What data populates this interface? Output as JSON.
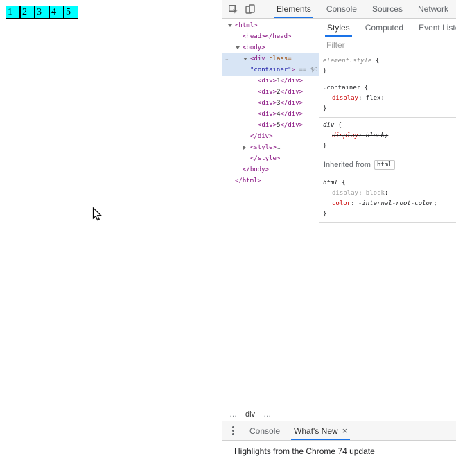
{
  "page": {
    "flex_items": [
      "1",
      "2",
      "3",
      "4",
      "5"
    ],
    "box_color": "#00ffff"
  },
  "devtools": {
    "colors": {
      "accent_blue": "#1a73e8",
      "selection": "#d8e5f5",
      "tag": "#881280",
      "attr_name": "#994500",
      "attr_value": "#1a1aa6",
      "prop_name": "#c80000"
    },
    "main_tabs": [
      {
        "label": "Elements",
        "selected": true
      },
      {
        "label": "Console",
        "selected": false
      },
      {
        "label": "Sources",
        "selected": false
      },
      {
        "label": "Network",
        "selected": false
      }
    ],
    "elements_tree": {
      "lines": [
        {
          "indent": 0,
          "arrow": "down",
          "tokens": [
            {
              "c": "tag",
              "t": "<html>"
            }
          ]
        },
        {
          "indent": 1,
          "tokens": [
            {
              "c": "tag",
              "t": "<head></head>"
            }
          ]
        },
        {
          "indent": 1,
          "arrow": "down",
          "tokens": [
            {
              "c": "tag",
              "t": "<body>"
            }
          ]
        },
        {
          "indent": 2,
          "arrow": "down",
          "selected": true,
          "gutter": "…",
          "tokens": [
            {
              "c": "tag",
              "t": "<div"
            },
            {
              "c": "attr",
              "t": " class="
            }
          ]
        },
        {
          "indent": 2,
          "selected": true,
          "tokens": [
            {
              "c": "val",
              "t": "\"container\""
            },
            {
              "c": "tag",
              "t": ">"
            },
            {
              "c": "anno",
              "t": " == $0"
            }
          ]
        },
        {
          "indent": 3,
          "tokens": [
            {
              "c": "tag",
              "t": "<div>"
            },
            {
              "c": "txt",
              "t": "1"
            },
            {
              "c": "tag",
              "t": "</div>"
            }
          ]
        },
        {
          "indent": 3,
          "tokens": [
            {
              "c": "tag",
              "t": "<div>"
            },
            {
              "c": "txt",
              "t": "2"
            },
            {
              "c": "tag",
              "t": "</div>"
            }
          ]
        },
        {
          "indent": 3,
          "tokens": [
            {
              "c": "tag",
              "t": "<div>"
            },
            {
              "c": "txt",
              "t": "3"
            },
            {
              "c": "tag",
              "t": "</div>"
            }
          ]
        },
        {
          "indent": 3,
          "tokens": [
            {
              "c": "tag",
              "t": "<div>"
            },
            {
              "c": "txt",
              "t": "4"
            },
            {
              "c": "tag",
              "t": "</div>"
            }
          ]
        },
        {
          "indent": 3,
          "tokens": [
            {
              "c": "tag",
              "t": "<div>"
            },
            {
              "c": "txt",
              "t": "5"
            },
            {
              "c": "tag",
              "t": "</div>"
            }
          ]
        },
        {
          "indent": 2,
          "tokens": [
            {
              "c": "tag",
              "t": "</div>"
            }
          ]
        },
        {
          "indent": 2,
          "arrow": "right",
          "tokens": [
            {
              "c": "tag",
              "t": "<style>"
            },
            {
              "c": "anno",
              "t": "…"
            }
          ]
        },
        {
          "indent": 2,
          "tokens": [
            {
              "c": "tag",
              "t": "</style>"
            }
          ]
        },
        {
          "indent": 1,
          "tokens": [
            {
              "c": "tag",
              "t": "</body>"
            }
          ]
        },
        {
          "indent": 0,
          "tokens": [
            {
              "c": "tag",
              "t": "</html>"
            }
          ]
        }
      ]
    },
    "breadcrumb": [
      {
        "t": "…",
        "current": false
      },
      {
        "t": "div",
        "current": true
      },
      {
        "t": "…",
        "current": false
      }
    ],
    "styles_pane": {
      "tabs": [
        {
          "label": "Styles",
          "selected": true
        },
        {
          "label": "Computed",
          "selected": false
        },
        {
          "label": "Event Listeners",
          "selected": false
        }
      ],
      "filter_placeholder": "Filter",
      "sections": [
        {
          "kind": "rule",
          "selector": [
            {
              "c": "elstyle",
              "t": "element.style"
            },
            {
              "c": "plain",
              "t": " {"
            }
          ],
          "props": [],
          "close": "}"
        },
        {
          "kind": "rule",
          "selector": [
            {
              "c": "sel",
              "t": ".container"
            },
            {
              "c": "plain",
              "t": " {"
            }
          ],
          "props": [
            {
              "name": "display",
              "value": "flex"
            }
          ],
          "close": "}"
        },
        {
          "kind": "rule",
          "selector": [
            {
              "c": "ua",
              "t": "div"
            },
            {
              "c": "plain",
              "t": " {"
            }
          ],
          "props": [
            {
              "name": "display",
              "value": "block",
              "struck": true
            }
          ],
          "close": "}"
        },
        {
          "kind": "inherited",
          "label": "Inherited from",
          "node": "html"
        },
        {
          "kind": "rule",
          "selector": [
            {
              "c": "ua",
              "t": "html"
            },
            {
              "c": "plain",
              "t": " {"
            }
          ],
          "props": [
            {
              "name": "display",
              "value": "block",
              "muted": true
            },
            {
              "name": "color",
              "value": "-internal-root-color",
              "italic_value": true
            }
          ],
          "close": "}"
        }
      ]
    },
    "drawer": {
      "tabs": [
        {
          "label": "Console",
          "selected": false,
          "closable": false
        },
        {
          "label": "What's New",
          "selected": true,
          "closable": true
        }
      ],
      "close_glyph": "×",
      "content_heading": "Highlights from the Chrome 74 update"
    }
  }
}
